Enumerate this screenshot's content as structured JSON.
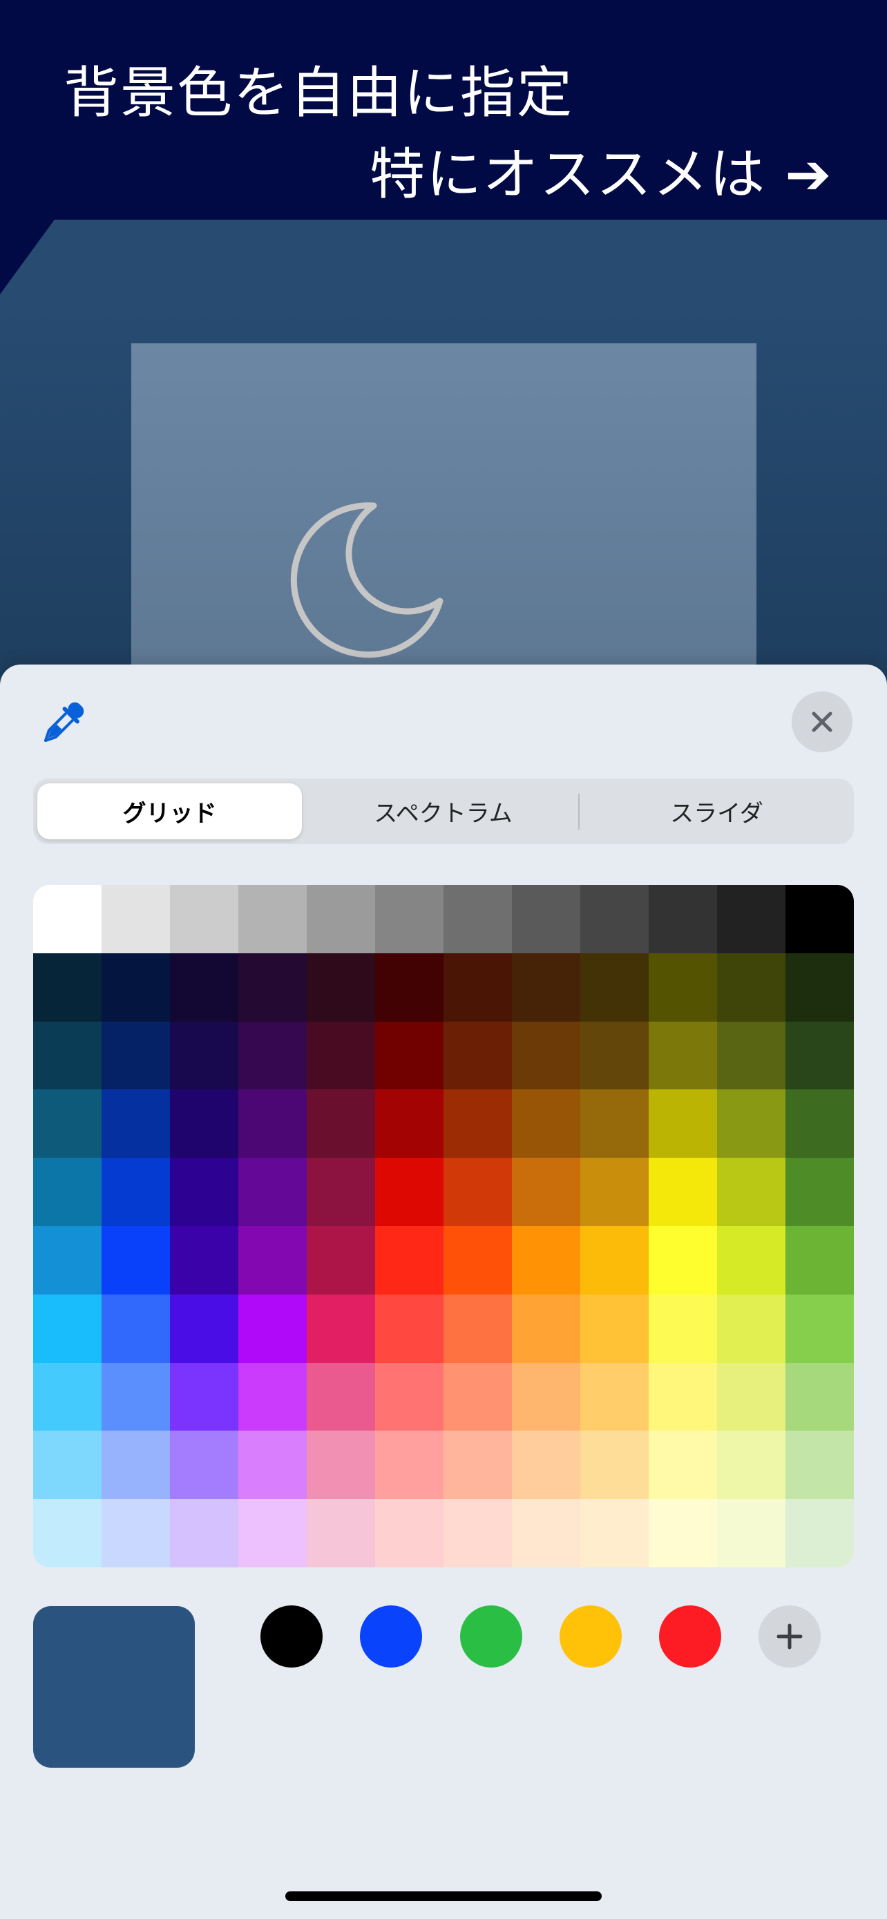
{
  "banner": {
    "line1": "背景色を自由に指定",
    "line2": "特にオススメは ➔"
  },
  "colors": {
    "banner_bg": "#020a45",
    "app_bg": "#274b71",
    "accent": "#0a60d8"
  },
  "picker": {
    "eyedropper_icon": "eyedropper-icon",
    "close_icon": "close-icon",
    "tabs": [
      {
        "label": "グリッド",
        "active": true
      },
      {
        "label": "スペクトラム",
        "active": false
      },
      {
        "label": "スライダ",
        "active": false
      }
    ],
    "grid_colors": [
      [
        "#ffffff",
        "#e3e3e3",
        "#cccccc",
        "#b3b3b3",
        "#9b9b9b",
        "#858585",
        "#6f6f6f",
        "#5a5a5a",
        "#464646",
        "#333333",
        "#222222",
        "#000000"
      ],
      [
        "#072538",
        "#041540",
        "#120833",
        "#240a33",
        "#2e0a1a",
        "#420203",
        "#4a1504",
        "#462207",
        "#443207",
        "#545301",
        "#3f4509",
        "#1d2e0e"
      ],
      [
        "#0b3c55",
        "#052266",
        "#18084d",
        "#35084f",
        "#480b21",
        "#710000",
        "#6b1f05",
        "#6b3a06",
        "#63460a",
        "#7c780a",
        "#5a6513",
        "#29461b"
      ],
      [
        "#0d5a7a",
        "#0530a0",
        "#1f046e",
        "#4d0774",
        "#6b0f2f",
        "#a30302",
        "#9b2c04",
        "#985506",
        "#966a0a",
        "#bcb402",
        "#8a9914",
        "#3d6b20"
      ],
      [
        "#0d76a8",
        "#063bd1",
        "#2d0192",
        "#640898",
        "#8c1340",
        "#dd0801",
        "#d13908",
        "#c96e0b",
        "#c88e0c",
        "#f3e80a",
        "#b9c815",
        "#4e8c28"
      ],
      [
        "#1390d6",
        "#0941fb",
        "#3a02a8",
        "#8408b1",
        "#ad1549",
        "#ff2716",
        "#ff5108",
        "#ff9305",
        "#fcbb09",
        "#fefd2e",
        "#d6ea26",
        "#6bb434"
      ],
      [
        "#19bdfc",
        "#3269fd",
        "#4a0de6",
        "#b008f8",
        "#e21f62",
        "#ff4840",
        "#fe7141",
        "#fea334",
        "#ffc237",
        "#fefa54",
        "#e1ef51",
        "#86cf4d"
      ],
      [
        "#44cafd",
        "#5b8ffe",
        "#7a34fe",
        "#ca3bfc",
        "#ea5a8e",
        "#ff7472",
        "#ff9270",
        "#feb56d",
        "#ffce6b",
        "#fff77c",
        "#e7f07c",
        "#a6d97c"
      ],
      [
        "#7ed8fe",
        "#97b3fe",
        "#a47dfe",
        "#d97efc",
        "#f190b2",
        "#ffa09f",
        "#ffb59b",
        "#ffcc9b",
        "#fedd98",
        "#fffaa8",
        "#eef6a8",
        "#c3e5a8"
      ],
      [
        "#c2ecfe",
        "#c9d8fe",
        "#d4c1fe",
        "#ecc1fd",
        "#f6c5d8",
        "#ffd0cf",
        "#ffdad0",
        "#ffe6cf",
        "#ffedcd",
        "#fffcd2",
        "#f6fad3",
        "#dcefd3"
      ]
    ],
    "current_color": "#2b5380",
    "presets": [
      "#000000",
      "#0a43fc",
      "#2bbe45",
      "#ffc208",
      "#fd1c23"
    ],
    "add_icon": "plus-icon"
  }
}
